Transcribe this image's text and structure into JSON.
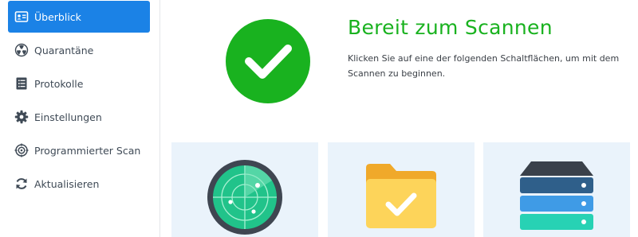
{
  "sidebar": {
    "items": [
      {
        "label": "Überblick",
        "icon": "overview-card-icon",
        "active": true
      },
      {
        "label": "Quarantäne",
        "icon": "biohazard-icon",
        "active": false
      },
      {
        "label": "Protokolle",
        "icon": "log-list-icon",
        "active": false
      },
      {
        "label": "Einstellungen",
        "icon": "gear-icon",
        "active": false
      },
      {
        "label": "Programmierter Scan",
        "icon": "scheduled-scan-target-icon",
        "active": false
      },
      {
        "label": "Aktualisieren",
        "icon": "refresh-icon",
        "active": false
      }
    ]
  },
  "status": {
    "title": "Bereit zum Scannen",
    "description": "Klicken Sie auf eine der folgenden Schaltflächen, um mit dem Scannen zu beginnen.",
    "icon": "ready-check-icon"
  },
  "scan_cards": [
    {
      "name": "full-scan",
      "icon": "radar-icon"
    },
    {
      "name": "custom-scan",
      "icon": "folder-check-icon"
    },
    {
      "name": "system-scan",
      "icon": "server-stack-icon"
    }
  ],
  "colors": {
    "accent": "#1b82e6",
    "success": "#19b21f",
    "card_bg": "#eaf3fb"
  }
}
